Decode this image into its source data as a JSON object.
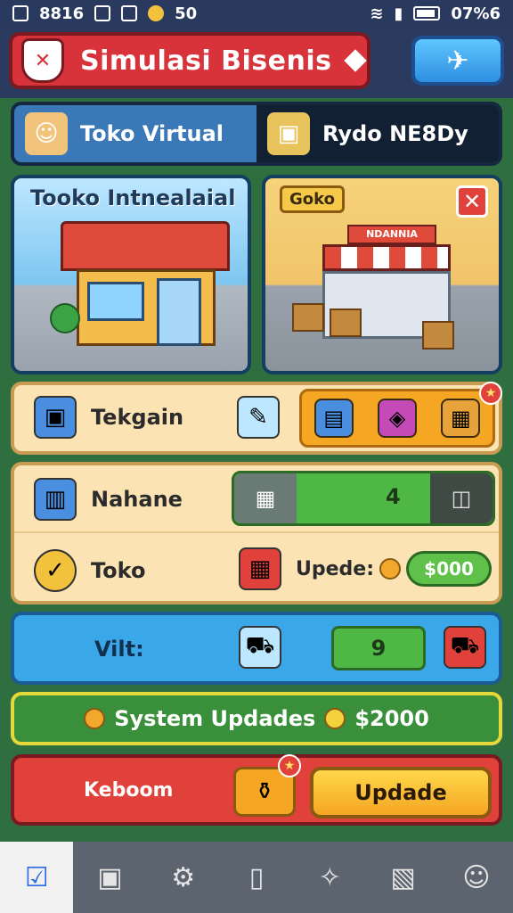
{
  "status_bar": {
    "left_text": "8816",
    "signal_text": "50",
    "right_text": "07%6"
  },
  "header": {
    "title": "Simulasi Bisenis",
    "shield_icon": "shield-icon",
    "top_button_icon": "map-icon"
  },
  "tabs": [
    {
      "label": "Toko Virtual",
      "icon": "shopkeeper-icon",
      "active": true
    },
    {
      "label": "Rydo NE8Dy",
      "icon": "box-icon",
      "active": false
    }
  ],
  "cards": [
    {
      "title": "Tooko Intnealaial"
    },
    {
      "badge": "Goko",
      "sign": "NDANNIA",
      "close_icon": "close-icon"
    }
  ],
  "tekgain": {
    "label": "Tekgain"
  },
  "stats": {
    "row1": {
      "label": "Nahane",
      "value": "4"
    },
    "row2": {
      "label": "Toko",
      "update_label": "Upede:",
      "amount": "$000"
    }
  },
  "blue_panel": {
    "label": "Vilt:",
    "value": "9"
  },
  "system": {
    "text": "System Updades",
    "amount": "$2000"
  },
  "red_panel": {
    "label": "Keboom",
    "button": "Updade"
  },
  "nav": [
    {
      "icon": "check-icon",
      "active": true
    },
    {
      "icon": "briefcase-icon"
    },
    {
      "icon": "gear-icon"
    },
    {
      "icon": "battery-icon"
    },
    {
      "icon": "puzzle-icon"
    },
    {
      "icon": "map-icon"
    },
    {
      "icon": "profile-icon"
    }
  ],
  "colors": {
    "accent_red": "#d8323a",
    "accent_blue": "#2e8fe0",
    "accent_green": "#4fb845",
    "accent_yellow": "#f5a623"
  }
}
